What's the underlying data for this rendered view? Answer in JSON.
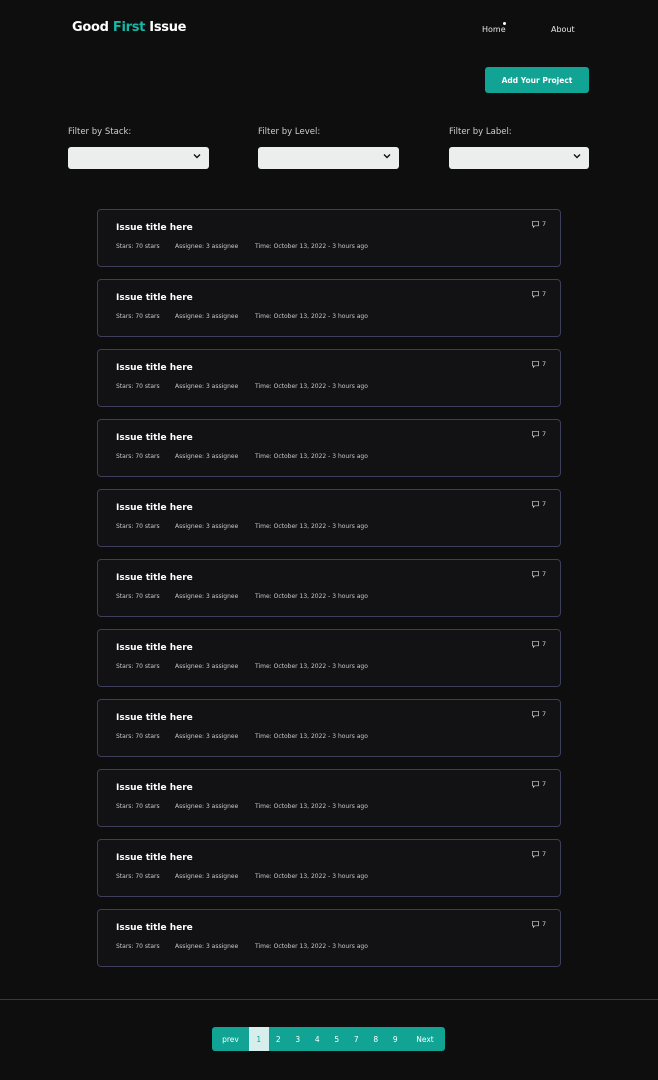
{
  "header": {
    "logo": {
      "part1": "Good ",
      "part2": "First",
      "part3": " Issue"
    },
    "nav": {
      "home": "Home",
      "about": "About"
    },
    "add_project_label": "Add Your Project"
  },
  "filters": [
    {
      "label": "Filter by Stack:",
      "value": ""
    },
    {
      "label": "Filter by Level:",
      "value": ""
    },
    {
      "label": "Filter by Label:",
      "value": ""
    }
  ],
  "issues": [
    {
      "title": "Issue title here",
      "stars": "Stars: 70 stars",
      "assignees": "Assignee: 3 assignee",
      "time": "Time: October 13, 2022 - 3 hours ago",
      "comments": "7"
    },
    {
      "title": "Issue title here",
      "stars": "Stars: 70 stars",
      "assignees": "Assignee: 3 assignee",
      "time": "Time: October 13, 2022 - 3 hours ago",
      "comments": "7"
    },
    {
      "title": "Issue title here",
      "stars": "Stars: 70 stars",
      "assignees": "Assignee: 3 assignee",
      "time": "Time: October 13, 2022 - 3 hours ago",
      "comments": "7"
    },
    {
      "title": "Issue title here",
      "stars": "Stars: 70 stars",
      "assignees": "Assignee: 3 assignee",
      "time": "Time: October 13, 2022 - 3 hours ago",
      "comments": "7"
    },
    {
      "title": "Issue title here",
      "stars": "Stars: 70 stars",
      "assignees": "Assignee: 3 assignee",
      "time": "Time: October 13, 2022 - 3 hours ago",
      "comments": "7"
    },
    {
      "title": "Issue title here",
      "stars": "Stars: 70 stars",
      "assignees": "Assignee: 3 assignee",
      "time": "Time: October 13, 2022 - 3 hours ago",
      "comments": "7"
    },
    {
      "title": "Issue title here",
      "stars": "Stars: 70 stars",
      "assignees": "Assignee: 3 assignee",
      "time": "Time: October 13, 2022 - 3 hours ago",
      "comments": "7"
    },
    {
      "title": "Issue title here",
      "stars": "Stars: 70 stars",
      "assignees": "Assignee: 3 assignee",
      "time": "Time: October 13, 2022 - 3 hours ago",
      "comments": "7"
    },
    {
      "title": "Issue title here",
      "stars": "Stars: 70 stars",
      "assignees": "Assignee: 3 assignee",
      "time": "Time: October 13, 2022 - 3 hours ago",
      "comments": "7"
    },
    {
      "title": "Issue title here",
      "stars": "Stars: 70 stars",
      "assignees": "Assignee: 3 assignee",
      "time": "Time: October 13, 2022 - 3 hours ago",
      "comments": "7"
    },
    {
      "title": "Issue title here",
      "stars": "Stars: 70 stars",
      "assignees": "Assignee: 3 assignee",
      "time": "Time: October 13, 2022 - 3 hours ago",
      "comments": "7"
    }
  ],
  "pagination": {
    "prev": "prev",
    "pages": [
      "1",
      "2",
      "3",
      "4",
      "5",
      "7",
      "8",
      "9"
    ],
    "active": "1",
    "next": "Next"
  },
  "colors": {
    "accent": "#14b8a6",
    "button": "#11a394",
    "background": "#0e0e0e",
    "card_border": "#3d3d5c"
  },
  "icons": {
    "comment": "comment-icon",
    "dropdown": "chevron-down-icon"
  }
}
